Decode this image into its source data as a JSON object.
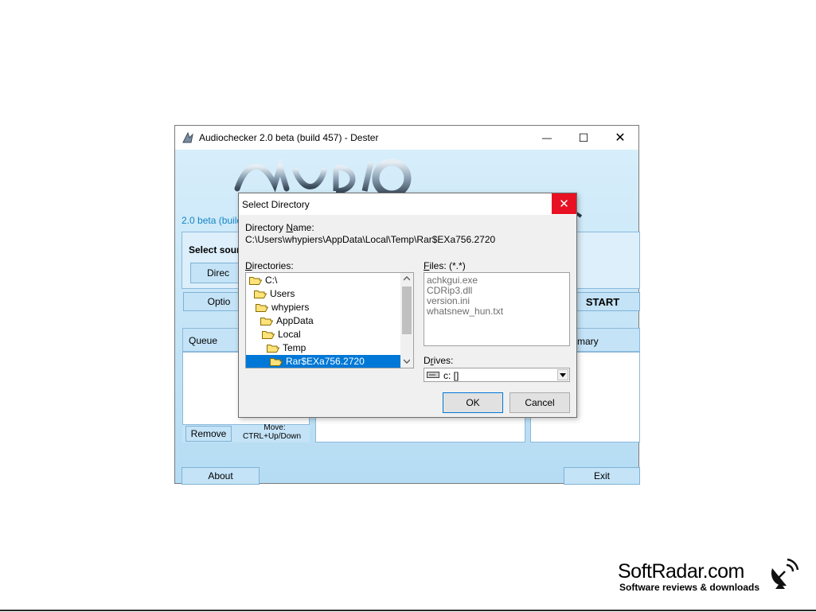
{
  "main_window": {
    "title": "Audiochecker 2.0 beta (build 457) - Dester",
    "min_glyph": "—",
    "max_glyph": "☐",
    "close_glyph": "✕",
    "version_text": "2.0 beta (build",
    "select_source_label": "Select sour",
    "directory_button": "Direc",
    "options_button": "Optio",
    "start_button": "START",
    "queue_label": "Queue",
    "summary_label": "mmary",
    "remove_button": "Remove",
    "move_hint_line1": "Move:",
    "move_hint_line2": "CTRL+Up/Down",
    "about_button": "About",
    "exit_button": "Exit"
  },
  "dialog": {
    "title": "Select Directory",
    "close_glyph": "✕",
    "directory_name_label": "Directory Name:",
    "directory_path": "C:\\Users\\whypiers\\AppData\\Local\\Temp\\Rar$EXa756.2720",
    "directories_label": "Directories:",
    "directories": [
      "C:\\",
      "Users",
      "whypiers",
      "AppData",
      "Local",
      "Temp",
      "Rar$EXa756.2720"
    ],
    "selected_directory": "Rar$EXa756.2720",
    "files_label": "Files: (*.*)",
    "files": [
      "achkgui.exe",
      "CDRip3.dll",
      "version.ini",
      "whatsnew_hun.txt"
    ],
    "drives_label": "Drives:",
    "drive_value": "c: []",
    "ok_button": "OK",
    "cancel_button": "Cancel"
  },
  "watermark": {
    "brand": "SoftRadar.com",
    "tagline": "Software reviews & downloads"
  },
  "colors": {
    "accent_selection": "#0078d7",
    "close_red": "#e81123",
    "app_blue": "#b9ddf3"
  }
}
